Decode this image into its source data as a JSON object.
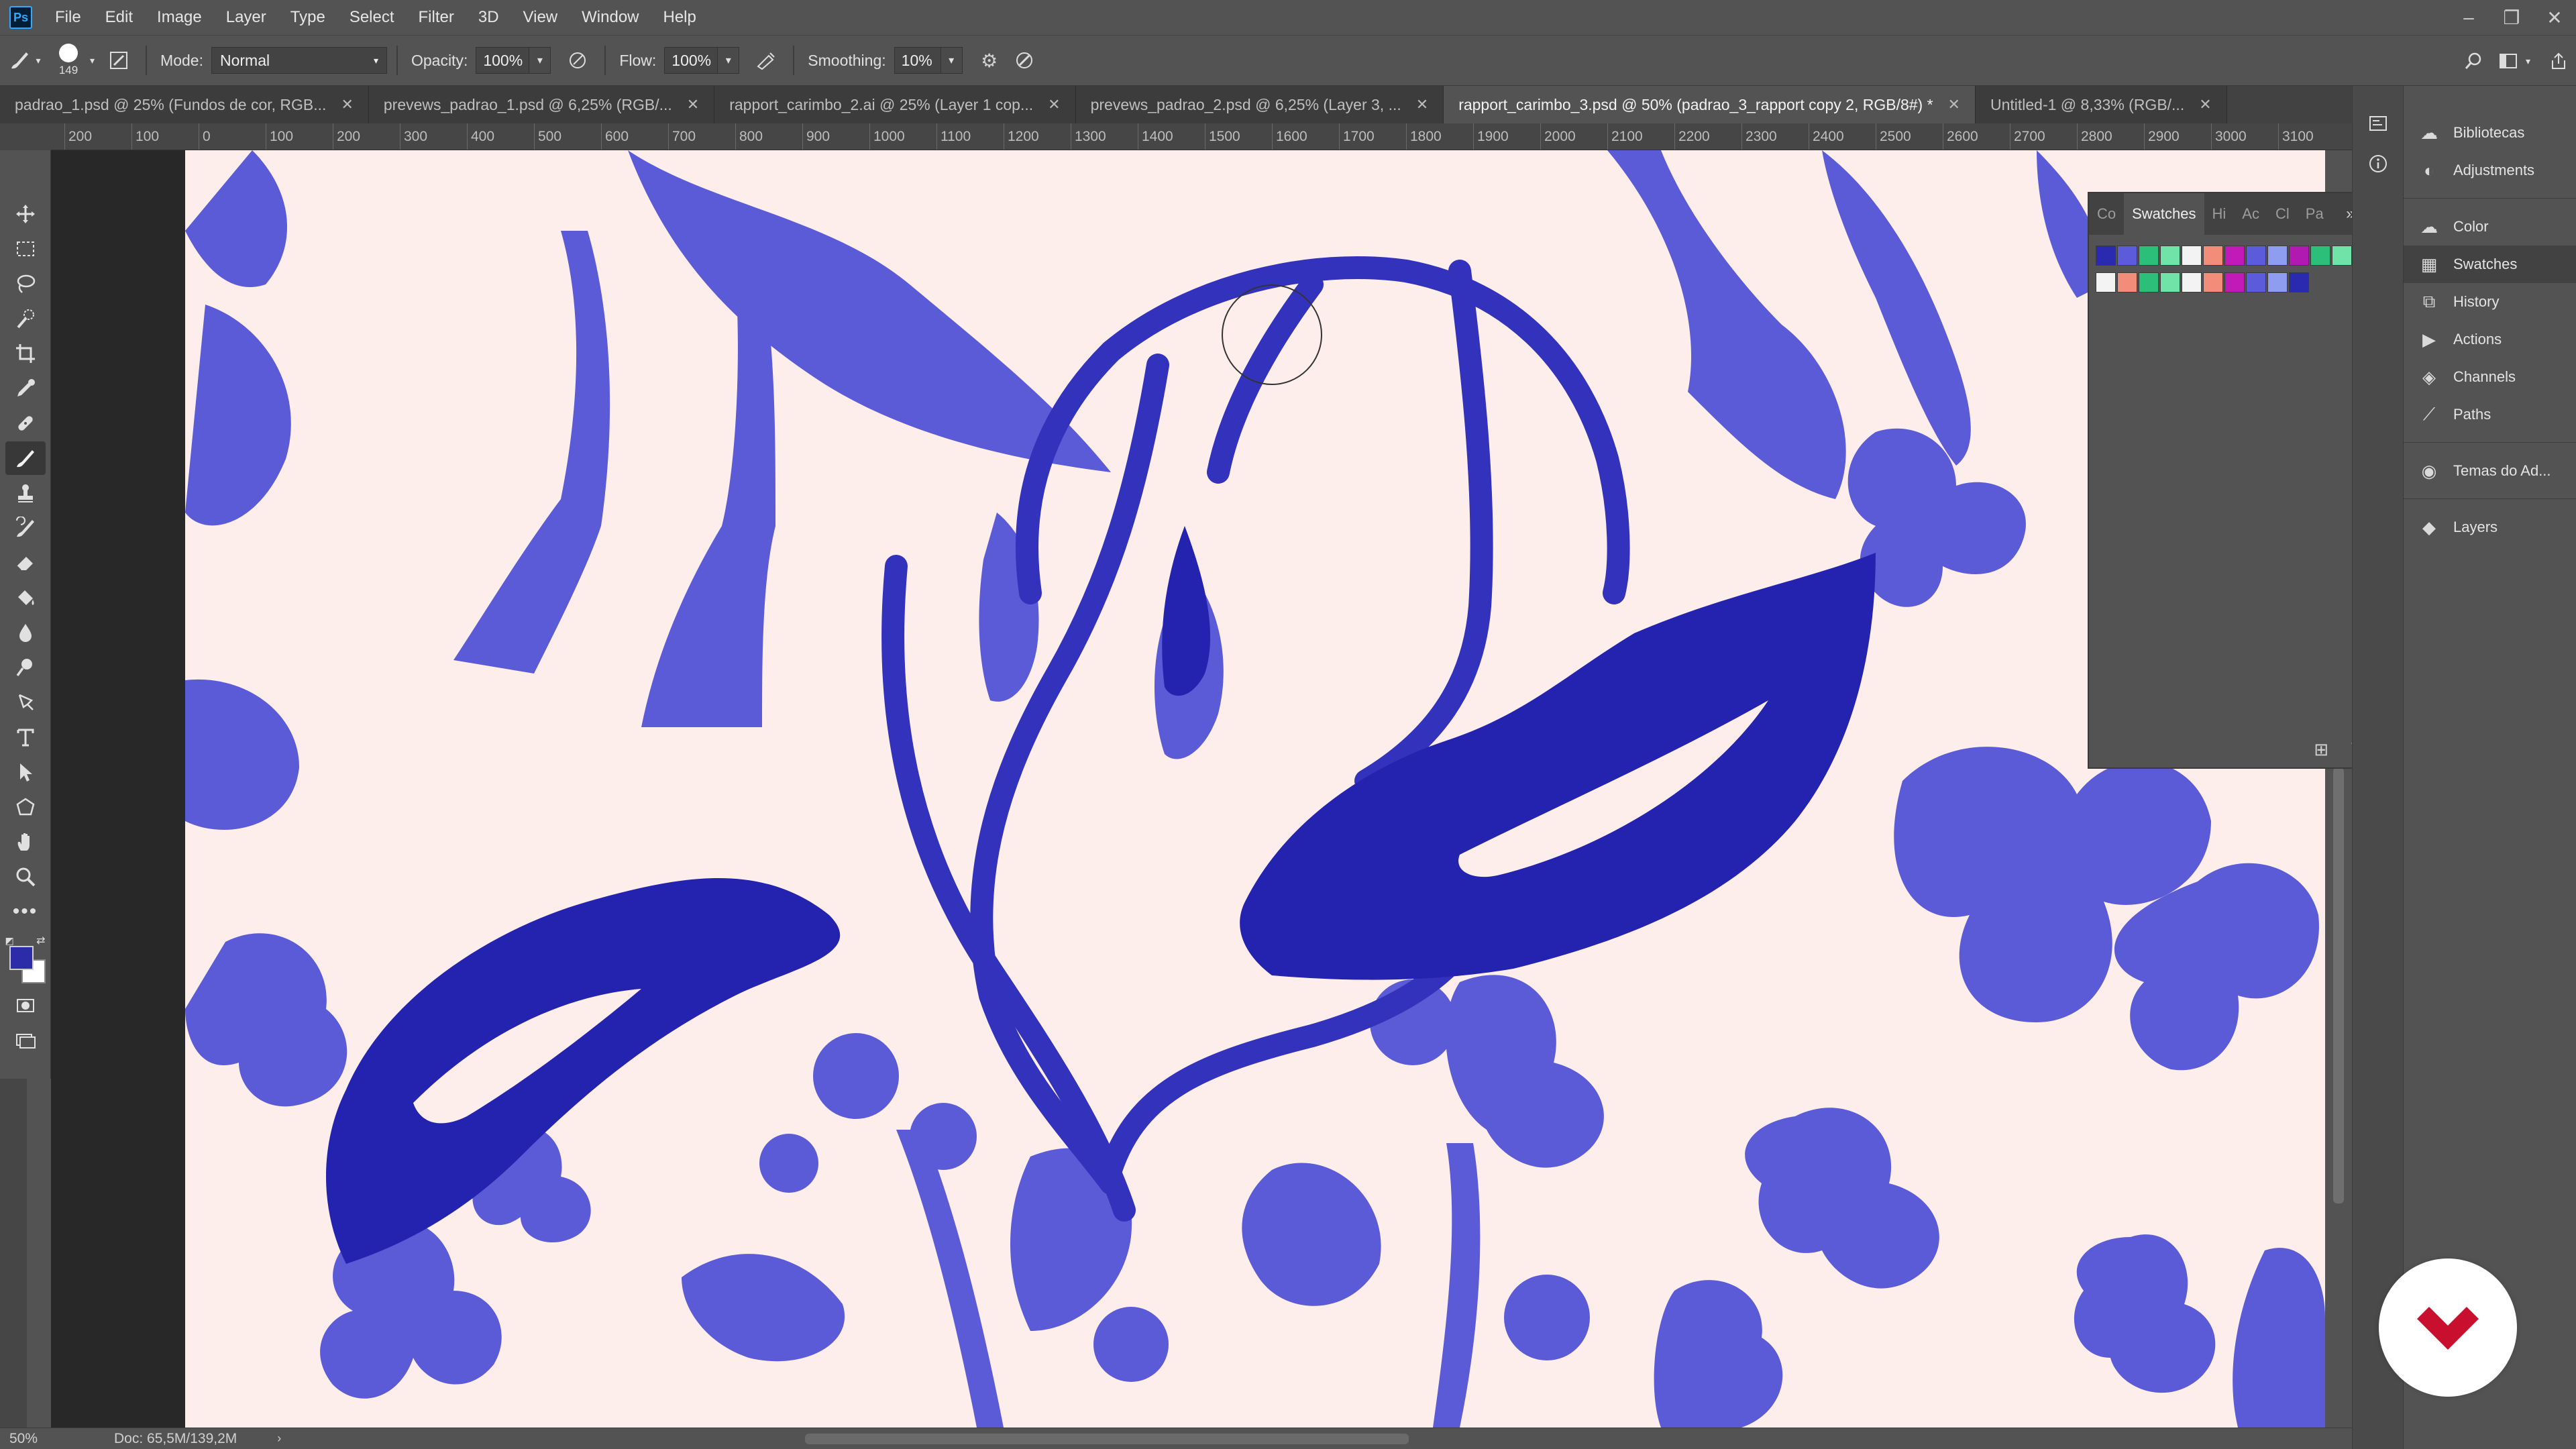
{
  "app": {
    "logo_text": "Ps"
  },
  "menu": [
    "File",
    "Edit",
    "Image",
    "Layer",
    "Type",
    "Select",
    "Filter",
    "3D",
    "View",
    "Window",
    "Help"
  ],
  "options": {
    "brush_size": "149",
    "mode_label": "Mode:",
    "mode_value": "Normal",
    "opacity_label": "Opacity:",
    "opacity_value": "100%",
    "flow_label": "Flow:",
    "flow_value": "100%",
    "smoothing_label": "Smoothing:",
    "smoothing_value": "10%"
  },
  "tabs": [
    {
      "label": "padrao_1.psd @ 25% (Fundos de cor, RGB...",
      "active": false
    },
    {
      "label": "prevews_padrao_1.psd @ 6,25% (RGB/...",
      "active": false
    },
    {
      "label": "rapport_carimbo_2.ai @ 25% (Layer 1 cop...",
      "active": false
    },
    {
      "label": "prevews_padrao_2.psd @ 6,25% (Layer 3, ...",
      "active": false
    },
    {
      "label": "rapport_carimbo_3.psd @ 50% (padrao_3_rapport copy 2, RGB/8#) *",
      "active": true
    },
    {
      "label": "Untitled-1 @ 8,33% (RGB/...",
      "active": false
    }
  ],
  "ruler_h": [
    "200",
    "100",
    "0",
    "100",
    "200",
    "300",
    "400",
    "500",
    "600",
    "700",
    "800",
    "900",
    "1000",
    "1100",
    "1200",
    "1300",
    "1400",
    "1500",
    "1600",
    "1700",
    "1800",
    "1900",
    "2000",
    "2100",
    "2200",
    "2300",
    "2400",
    "2500",
    "2600",
    "2700",
    "2800",
    "2900",
    "3000",
    "3100"
  ],
  "colors": {
    "foreground": "#2c2ca8",
    "background": "#ffffff",
    "canvas_bg": "#fdeeec",
    "ink_light": "#5a5ad6",
    "ink_dark": "#2222b0"
  },
  "swatches_panel": {
    "tabs": [
      "Co",
      "Swatches",
      "Hi",
      "Ac",
      "Cl",
      "Pa"
    ],
    "active_tab": "Swatches",
    "swatches": [
      "#2a2ab0",
      "#5b5bdc",
      "#2bbf7a",
      "#6fe3a8",
      "#f3f3f3",
      "#f28d7a",
      "#c21ab8",
      "#5b5bdc",
      "#8f9df0",
      "#b01ab0",
      "#2bbf7a",
      "#6fe3a8",
      "#f3f3f3",
      "#f28d7a",
      "#2bbf7a",
      "#6fe3a8",
      "#f3f3f3",
      "#f28d7a",
      "#c21ab8",
      "#5b5bdc",
      "#8f9df0",
      "#2a2ab0"
    ]
  },
  "dock": [
    {
      "label": "Bibliotecas",
      "icon": "libraries-icon"
    },
    {
      "label": "Adjustments",
      "icon": "adjustments-icon"
    },
    {
      "label": "Color",
      "icon": "color-icon"
    },
    {
      "label": "Swatches",
      "icon": "swatches-icon",
      "active": true
    },
    {
      "label": "History",
      "icon": "history-icon"
    },
    {
      "label": "Actions",
      "icon": "actions-icon"
    },
    {
      "label": "Channels",
      "icon": "channels-icon"
    },
    {
      "label": "Paths",
      "icon": "paths-icon"
    },
    {
      "label": "Temas do Ad...",
      "icon": "themes-icon"
    },
    {
      "label": "Layers",
      "icon": "layers-icon"
    }
  ],
  "status": {
    "zoom": "50%",
    "doc": "Doc: 65,5M/139,2M"
  }
}
